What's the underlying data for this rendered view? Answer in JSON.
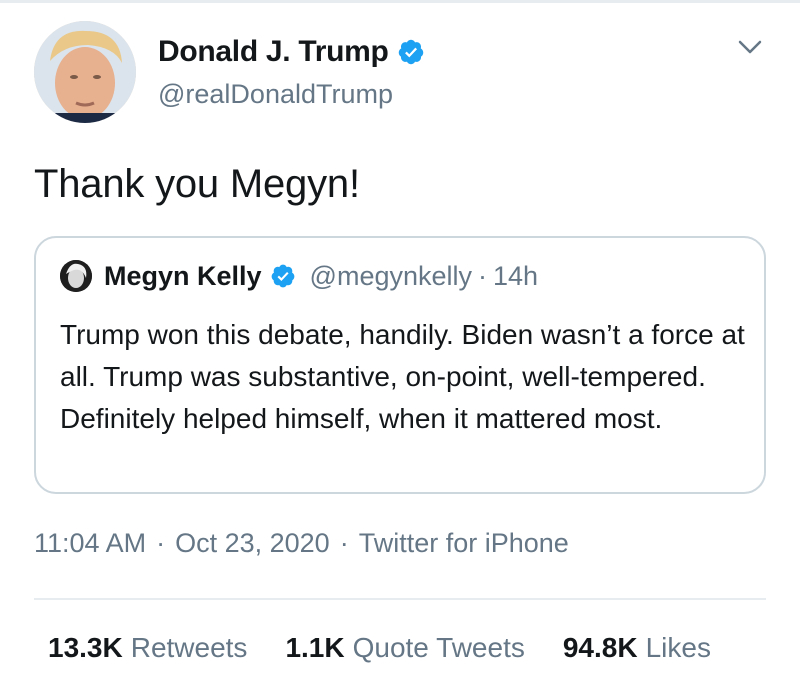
{
  "tweet": {
    "author": {
      "display_name": "Donald J. Trump",
      "handle": "@realDonaldTrump",
      "verified": true
    },
    "text": "Thank you Megyn!",
    "quoted": {
      "display_name": "Megyn Kelly",
      "handle": "@megynkelly",
      "separator": "·",
      "time": "14h",
      "verified": true,
      "text": "Trump won this debate, handily. Biden wasn’t a force at all. Trump was substantive, on-point, well-tempered. Definitely helped himself, when it mattered most."
    },
    "timestamp": {
      "time": "11:04 AM",
      "separator1": "·",
      "date": "Oct 23, 2020",
      "separator2": "·",
      "source": "Twitter for iPhone"
    },
    "stats": {
      "retweets_count": "13.3K",
      "retweets_label": "Retweets",
      "quotes_count": "1.1K",
      "quotes_label": "Quote Tweets",
      "likes_count": "94.8K",
      "likes_label": "Likes"
    }
  },
  "icons": {
    "verified": "verified-badge-icon",
    "chevron": "chevron-down-icon"
  },
  "colors": {
    "verified_blue": "#1da1f2",
    "secondary_text": "#657786",
    "border": "#ccd6dd",
    "divider": "#e6ecf0"
  }
}
